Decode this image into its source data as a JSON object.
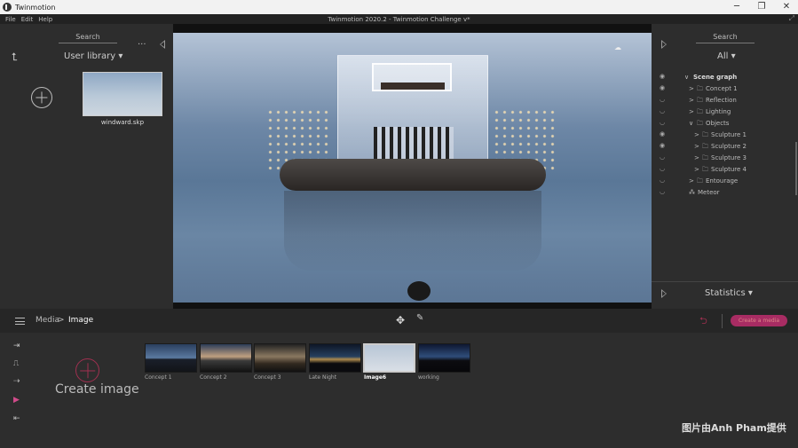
{
  "app": {
    "name": "Twinmotion",
    "window_title": "Twinmotion 2020.2 - Twinmotion Challenge v*"
  },
  "window_controls": {
    "minimize": "─",
    "maximize": "❐",
    "close": "✕",
    "expand": "⤢"
  },
  "menu": [
    "File",
    "Edit",
    "Help"
  ],
  "left_panel": {
    "search_label": "Search",
    "more": "...",
    "up": "⮤",
    "library_dropdown": "User library ▾",
    "thumbnail_caption": "windward.skp"
  },
  "viewport": {
    "cloud": "☁"
  },
  "right_panel": {
    "search_label": "Search",
    "filter": "All ▾",
    "scene_graph": [
      {
        "label": "Scene graph",
        "toggle": "∨",
        "folder": false,
        "eye": "◉",
        "bold": true
      },
      {
        "label": "Concept 1",
        "toggle": ">",
        "folder": true,
        "eye": "◉",
        "bold": false
      },
      {
        "label": "Reflection",
        "toggle": ">",
        "folder": true,
        "eye": "◡",
        "bold": false
      },
      {
        "label": "Lighting",
        "toggle": ">",
        "folder": true,
        "eye": "◡",
        "bold": false
      },
      {
        "label": "Objects",
        "toggle": "∨",
        "folder": true,
        "eye": "◡",
        "bold": false
      },
      {
        "label": "Sculpture 1",
        "toggle": ">",
        "folder": true,
        "eye": "◉",
        "bold": false
      },
      {
        "label": "Sculpture 2",
        "toggle": ">",
        "folder": true,
        "eye": "◉",
        "bold": false
      },
      {
        "label": "Sculpture 3",
        "toggle": ">",
        "folder": true,
        "eye": "◡",
        "bold": false
      },
      {
        "label": "Sculpture 4",
        "toggle": ">",
        "folder": true,
        "eye": "◡",
        "bold": false
      },
      {
        "label": "Entourage",
        "toggle": ">",
        "folder": true,
        "eye": "◡",
        "bold": false
      },
      {
        "label": "Meteor",
        "toggle": "⁂",
        "folder": false,
        "eye": "◡",
        "bold": false
      }
    ],
    "statistics": "Statistics ▾"
  },
  "toolbar": {
    "breadcrumb": [
      "Media",
      ">",
      "Image"
    ],
    "move_icon": "✥",
    "pen_icon": "✎",
    "undo_icon": "⮌",
    "render_button": "Create a media"
  },
  "bottom": {
    "side_icons": [
      "⇥",
      "⎍",
      "⇢",
      "▶",
      "⇤"
    ],
    "create_label": "Create image",
    "media": [
      {
        "caption": "Concept 1",
        "selected": false
      },
      {
        "caption": "Concept 2",
        "selected": false
      },
      {
        "caption": "Concept 3",
        "selected": false
      },
      {
        "caption": "Late Night",
        "selected": false
      },
      {
        "caption": "Image6",
        "selected": true
      },
      {
        "caption": "working",
        "selected": false
      }
    ]
  },
  "watermark": "图片由Anh Pham提供"
}
